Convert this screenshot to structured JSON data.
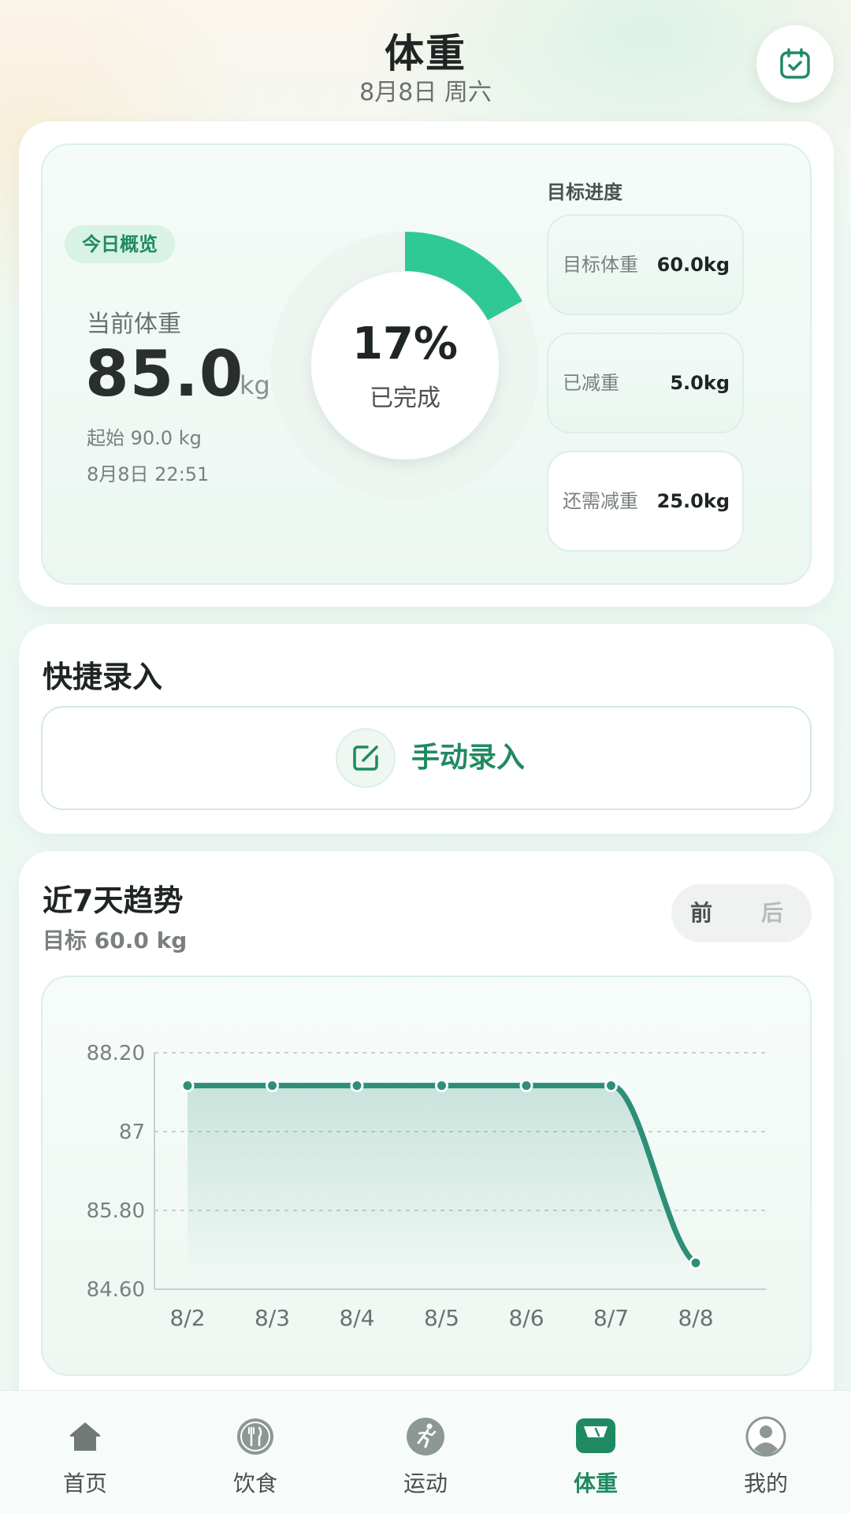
{
  "header": {
    "title": "体重",
    "date": "8月8日 周六"
  },
  "summary": {
    "badge": "今日概览",
    "current_label": "当前体重",
    "current_value": "85.0",
    "unit": "kg",
    "start": "起始 90.0 kg",
    "time": "8月8日 22:51",
    "progress_percent": "17%",
    "progress_fraction": 0.17,
    "progress_label": "已完成",
    "goal_section_title": "目标进度",
    "goals": [
      {
        "label": "目标体重",
        "value": "60.0kg"
      },
      {
        "label": "已减重",
        "value": "5.0kg"
      },
      {
        "label": "还需减重",
        "value": "25.0kg"
      }
    ]
  },
  "quick": {
    "title": "快捷录入",
    "manual_label": "手动录入"
  },
  "trend": {
    "title": "近7天趋势",
    "subtitle": "目标 60.0 kg",
    "prev_label": "前",
    "next_label": "后"
  },
  "chart_data": {
    "type": "line",
    "categories": [
      "8/2",
      "8/3",
      "8/4",
      "8/5",
      "8/6",
      "8/7",
      "8/8"
    ],
    "values": [
      87.7,
      87.7,
      87.7,
      87.7,
      87.7,
      87.7,
      85.0
    ],
    "ylim": [
      84.6,
      88.2
    ],
    "yticks": [
      "84.60",
      "85.80",
      "87",
      "88.20"
    ],
    "ytick_values": [
      84.6,
      85.8,
      87.0,
      88.2
    ],
    "grid": true,
    "color": "#2e8f78"
  },
  "tabs": [
    {
      "label": "首页",
      "icon": "home-icon"
    },
    {
      "label": "饮食",
      "icon": "dining-icon"
    },
    {
      "label": "运动",
      "icon": "running-icon"
    },
    {
      "label": "体重",
      "icon": "scale-icon",
      "active": true
    },
    {
      "label": "我的",
      "icon": "profile-icon"
    }
  ],
  "colors": {
    "accent": "#1f8a62",
    "donut": "#2ec994",
    "line": "#2e8f78"
  }
}
